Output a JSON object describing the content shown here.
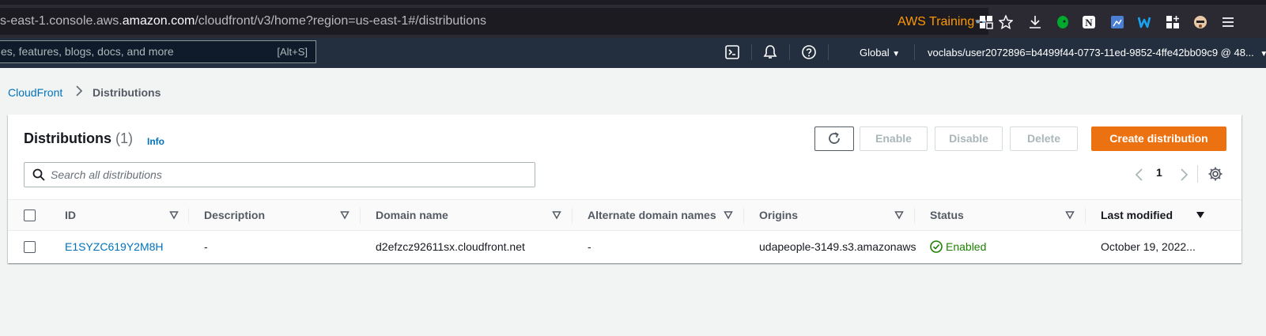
{
  "browser": {
    "url_prefix": "s-east-1.console.aws.",
    "url_host": "amazon.com",
    "url_suffix": "/cloudfront/v3/home?region=us-east-1#/distributions",
    "aws_training": "AWS Training"
  },
  "aws_header": {
    "search_placeholder": "es, features, blogs, docs, and more",
    "search_shortcut": "[Alt+S]",
    "region": "Global",
    "account": "voclabs/user2072896=b4499f44-0773-11ed-9852-4ffe42bb09c9 @ 48..."
  },
  "breadcrumb": {
    "parent": "CloudFront",
    "current": "Distributions"
  },
  "panel": {
    "title": "Distributions",
    "count": "(1)",
    "info": "Info",
    "buttons": {
      "enable": "Enable",
      "disable": "Disable",
      "delete": "Delete",
      "create": "Create distribution"
    },
    "search_placeholder": "Search all distributions",
    "page": "1"
  },
  "table": {
    "columns": [
      "ID",
      "Description",
      "Domain name",
      "Alternate domain names",
      "Origins",
      "Status",
      "Last modified"
    ],
    "rows": [
      {
        "id": "E1SYZC619Y2M8H",
        "description": "-",
        "domain": "d2efzcz92611sx.cloudfront.net",
        "alternate": "-",
        "origins": "udapeople-3149.s3.amazonaws",
        "status": "Enabled",
        "last_modified": "October 19, 2022..."
      }
    ]
  },
  "colors": {
    "accent": "#ec7211",
    "link": "#0073bb",
    "success": "#1d8102",
    "header_bg": "#232f3e"
  }
}
